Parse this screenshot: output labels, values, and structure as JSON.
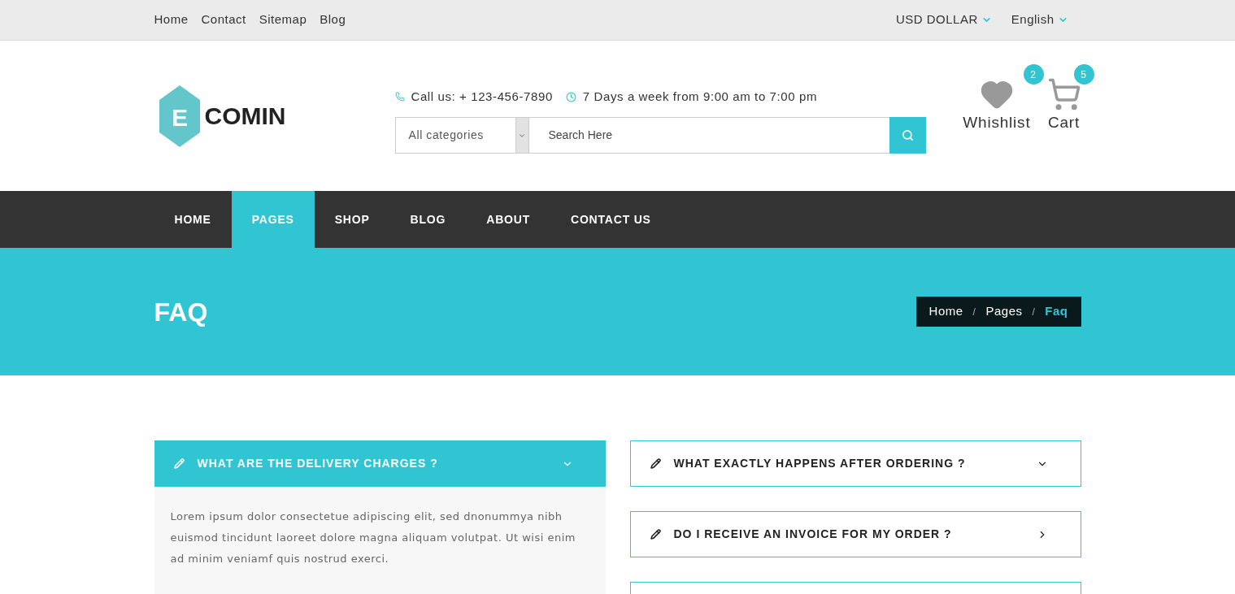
{
  "top_links": [
    "Home",
    "Contact",
    "Sitemap",
    "Blog"
  ],
  "top_dropdowns": [
    "USD DOLLAR",
    "English"
  ],
  "logo": {
    "letter": "E",
    "name": "COMIN"
  },
  "contact": {
    "phone": "Call us: + 123-456-7890",
    "hours": "7 Days a week from 9:00 am to 7:00 pm"
  },
  "search": {
    "category": "All categories",
    "placeholder": "Search Here"
  },
  "header_icons": [
    {
      "kind": "heart",
      "label": "Whishlist",
      "count": "2"
    },
    {
      "kind": "cart",
      "label": "Cart",
      "count": "5"
    }
  ],
  "nav": [
    {
      "label": "HOME",
      "selected": false
    },
    {
      "label": "PAGES",
      "selected": true
    },
    {
      "label": "SHOP",
      "selected": false
    },
    {
      "label": "BLOG",
      "selected": false
    },
    {
      "label": "ABOUT",
      "selected": false
    },
    {
      "label": "CONTACT US",
      "selected": false
    }
  ],
  "banner": {
    "title": "FAQ",
    "separator": "/",
    "breadcrumb": [
      {
        "label": "Home",
        "selected": false
      },
      {
        "label": "Pages",
        "selected": false
      },
      {
        "label": "Faq",
        "selected": true
      }
    ]
  },
  "faq_left": [
    {
      "question": "WHAT ARE THE DELIVERY CHARGES ?",
      "expanded": true,
      "kind": "dropdown",
      "answer": "Lorem ipsum dolor consectetue adipiscing elit, sed dnonummya nibh euismod tincidunt laoreet dolore magna aliquam volutpat. Ut wisi enim ad minim veniamf quis nostrud exerci."
    }
  ],
  "faq_right": [
    {
      "question": "WHAT EXACTLY HAPPENS AFTER ORDERING ?",
      "expanded": false,
      "kind": "dropdown"
    },
    {
      "question": "DO I RECEIVE AN INVOICE FOR MY ORDER ?",
      "expanded": false,
      "kind": "link"
    }
  ]
}
